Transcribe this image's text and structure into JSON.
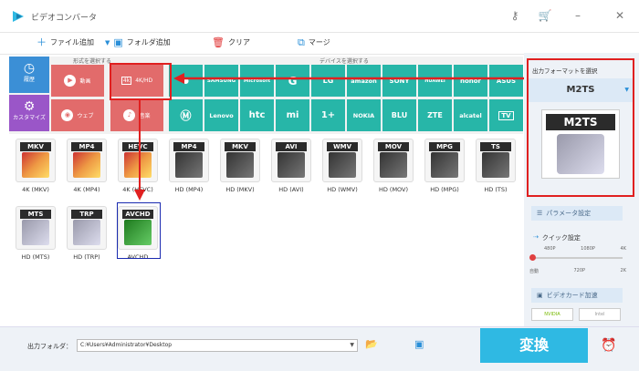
{
  "window": {
    "title": "ビデオコンバータ"
  },
  "toolbar": {
    "add_file": "ファイル追加",
    "add_folder": "フォルダ追加",
    "clear": "クリア",
    "merge": "マージ"
  },
  "categories": {
    "format_header": "形式を選択する",
    "device_header": "デバイスを選択する",
    "history": "履歴",
    "custom": "カスタマイズ",
    "format_items": [
      {
        "label": "動画",
        "icon": "play-icon"
      },
      {
        "label": "4K/HD",
        "icon": "4k-icon"
      },
      {
        "label": "ウェブ",
        "icon": "chrome-icon"
      },
      {
        "label": "音楽",
        "icon": "speaker-icon"
      }
    ],
    "brands_row1": [
      "",
      "SAMSUNG",
      "Microsoft",
      "G",
      "LG",
      "amazon",
      "SONY",
      "HUAWEI",
      "honor",
      "ASUS"
    ],
    "brands_row2": [
      "",
      "Lenovo",
      "htc",
      "mi",
      "1+",
      "NOKIA",
      "BLU",
      "ZTE",
      "alcatel",
      "TV"
    ]
  },
  "formats": [
    {
      "badge": "MKV",
      "label": "4K (MKV)",
      "style": "4k"
    },
    {
      "badge": "MP4",
      "label": "4K (MP4)",
      "style": "4k"
    },
    {
      "badge": "HEVC",
      "label": "4K (HEVC)",
      "style": "4k"
    },
    {
      "badge": "MP4",
      "label": "HD (MP4)",
      "style": "film"
    },
    {
      "badge": "MKV",
      "label": "HD (MKV)",
      "style": "film"
    },
    {
      "badge": "AVI",
      "label": "HD (AVI)",
      "style": "film"
    },
    {
      "badge": "WMV",
      "label": "HD (WMV)",
      "style": "film"
    },
    {
      "badge": "MOV",
      "label": "HD (MOV)",
      "style": "film"
    },
    {
      "badge": "MPG",
      "label": "HD (MPG)",
      "style": "film"
    },
    {
      "badge": "TS",
      "label": "HD (TS)",
      "style": "film"
    },
    {
      "badge": "MTS",
      "label": "HD (MTS)",
      "style": "cam"
    },
    {
      "badge": "TRP",
      "label": "HD (TRP)",
      "style": "cam"
    },
    {
      "badge": "AVCHD",
      "label": "AVCHD",
      "style": "green"
    }
  ],
  "right_panel": {
    "heading": "出力フォーマットを選択",
    "selected": "M2TS",
    "preview_text": "M2TS",
    "params_button": "パラメータ設定",
    "quick_label": "クイック設定",
    "quick_top": [
      "480P",
      "1080P",
      "4K"
    ],
    "quick_bottom": [
      "自動",
      "720P",
      "2K"
    ],
    "gpu_label": "ビデオカード加速",
    "gpu_nvidia": "NVIDIA",
    "gpu_intel": "Intel"
  },
  "bottom": {
    "folder_label": "出力フォルダ：",
    "folder_path": "C:¥Users¥Administrator¥Desktop",
    "convert": "変換"
  },
  "colors": {
    "accent": "#2fb9e3",
    "red_cell": "#e26b6b",
    "teal_cell": "#27b6a8",
    "highlight": "#e02020"
  }
}
